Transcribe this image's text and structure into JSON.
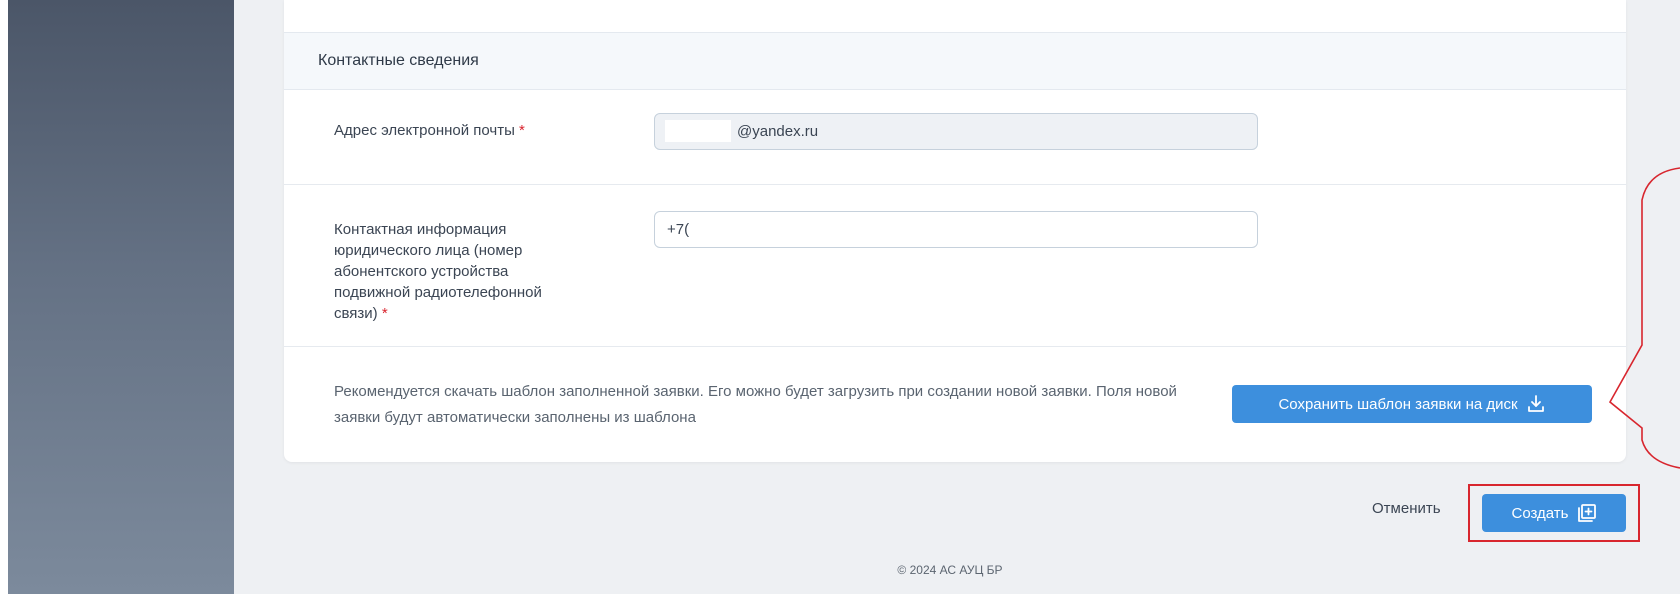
{
  "section": {
    "title": "Контактные сведения"
  },
  "fields": {
    "email": {
      "label": "Адрес электронной почты",
      "required_mark": "*",
      "value": "@yandex.ru"
    },
    "phone": {
      "label": "Контактная информация юридического лица (номер абонентского устройства подвижной радиотелефонной связи)",
      "required_mark": "*",
      "value": "+7("
    }
  },
  "template": {
    "text": "Рекомендуется скачать шаблон заполненной заявки. Его можно будет загрузить при создании новой заявки. Поля новой заявки будут автоматически заполнены из шаблона",
    "save_button": "Сохранить шаблон заявки на диск",
    "save_icon": "download-icon"
  },
  "actions": {
    "cancel": "Отменить",
    "create": "Создать",
    "create_icon": "add-box-icon"
  },
  "footer": {
    "copyright": "© 2024 АС АУЦ БР"
  },
  "colors": {
    "primary": "#3d8fdd",
    "highlight": "#d8262e",
    "required": "#d9232d"
  }
}
